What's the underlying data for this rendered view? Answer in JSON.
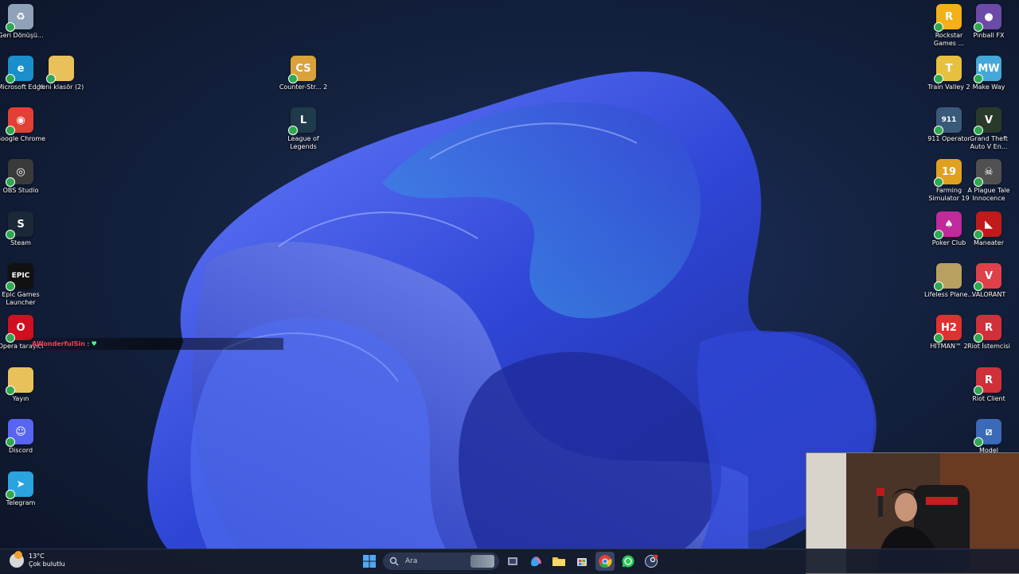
{
  "desktop": {
    "left_icons": [
      {
        "id": "recycle-bin",
        "label": "Geri Dönüşü...",
        "color": "#8fa2b8",
        "glyph": "♻"
      },
      {
        "id": "microsoft-edge",
        "label": "Microsoft Edge",
        "color": "#1a8fc9",
        "glyph": "e"
      },
      {
        "id": "new-folder",
        "label": "Yeni klasör (2)",
        "color": "#e8c15a",
        "glyph": ""
      },
      {
        "id": "google-chrome",
        "label": "Google Chrome",
        "color": "#e24035",
        "glyph": "◉"
      },
      {
        "id": "obs-studio",
        "label": "OBS Studio",
        "color": "#3a3a3a",
        "glyph": "◎"
      },
      {
        "id": "steam",
        "label": "Steam",
        "color": "#1b2838",
        "glyph": "S"
      },
      {
        "id": "epic-games",
        "label": "Epic Games Launcher",
        "color": "#111111",
        "glyph": "EPIC"
      },
      {
        "id": "opera",
        "label": "Opera tarayıcı",
        "color": "#d01020",
        "glyph": "O"
      },
      {
        "id": "yayin-folder",
        "label": "Yayın",
        "color": "#e8c15a",
        "glyph": ""
      },
      {
        "id": "discord",
        "label": "Discord",
        "color": "#5865f2",
        "glyph": "☺"
      },
      {
        "id": "telegram",
        "label": "Telegram",
        "color": "#2aa3de",
        "glyph": "➤"
      },
      {
        "id": "counter-strike",
        "label": "Counter-Str... 2",
        "color": "#d9a23a",
        "glyph": "CS"
      },
      {
        "id": "league-of-legends",
        "label": "League of Legends",
        "color": "#1f3a4a",
        "glyph": "L"
      }
    ],
    "right_icons": [
      {
        "id": "rockstar",
        "label": "Rockstar Games ...",
        "color": "#f4b018",
        "glyph": "R"
      },
      {
        "id": "pinball-fx",
        "label": "Pinball FX",
        "color": "#6b4aa8",
        "glyph": "●"
      },
      {
        "id": "train-valley",
        "label": "Train Valley 2",
        "color": "#e8c040",
        "glyph": "T"
      },
      {
        "id": "make-way",
        "label": "Make Way",
        "color": "#44a8d8",
        "glyph": "MW"
      },
      {
        "id": "911-operator",
        "label": "911 Operator",
        "color": "#3a5a7a",
        "glyph": "911"
      },
      {
        "id": "gta-v",
        "label": "Grand Theft Auto V En...",
        "color": "#2a3a2a",
        "glyph": "V"
      },
      {
        "id": "farming-sim",
        "label": "Farming Simulator 19",
        "color": "#e0a020",
        "glyph": "19"
      },
      {
        "id": "plague-tale",
        "label": "A Plague Tale Innocence",
        "color": "#505050",
        "glyph": "☠"
      },
      {
        "id": "poker-club",
        "label": "Poker Club",
        "color": "#c02a9a",
        "glyph": "♠"
      },
      {
        "id": "maneater",
        "label": "Maneater",
        "color": "#c01a1a",
        "glyph": "◣"
      },
      {
        "id": "lifeless-planet",
        "label": "Lifeless Plane...",
        "color": "#b8a060",
        "glyph": ""
      },
      {
        "id": "valorant",
        "label": "VALORANT",
        "color": "#e0404a",
        "glyph": "V"
      },
      {
        "id": "hitman",
        "label": "HITMAN™ 2",
        "color": "#e03030",
        "glyph": "H2"
      },
      {
        "id": "riot-istemcisi",
        "label": "Riot İstemcisi",
        "color": "#d0303a",
        "glyph": "R"
      },
      {
        "id": "riot-client",
        "label": "Riot Client",
        "color": "#d0303a",
        "glyph": "R"
      },
      {
        "id": "model",
        "label": "Model",
        "color": "#3a6ab8",
        "glyph": "⧄"
      }
    ]
  },
  "chat": {
    "user": "AWonderfulSin",
    "separator": ":",
    "message": "♥"
  },
  "taskbar": {
    "weather_temp": "13°C",
    "weather_desc": "Çok bulutlu",
    "search_placeholder": "Ara",
    "pinned": [
      "start",
      "search",
      "task-view",
      "copilot",
      "file-explorer",
      "store",
      "chrome",
      "whatsapp",
      "steam-notif"
    ]
  },
  "colors": {
    "accent": "#4a6cf7",
    "taskbar": "#161c2c"
  }
}
